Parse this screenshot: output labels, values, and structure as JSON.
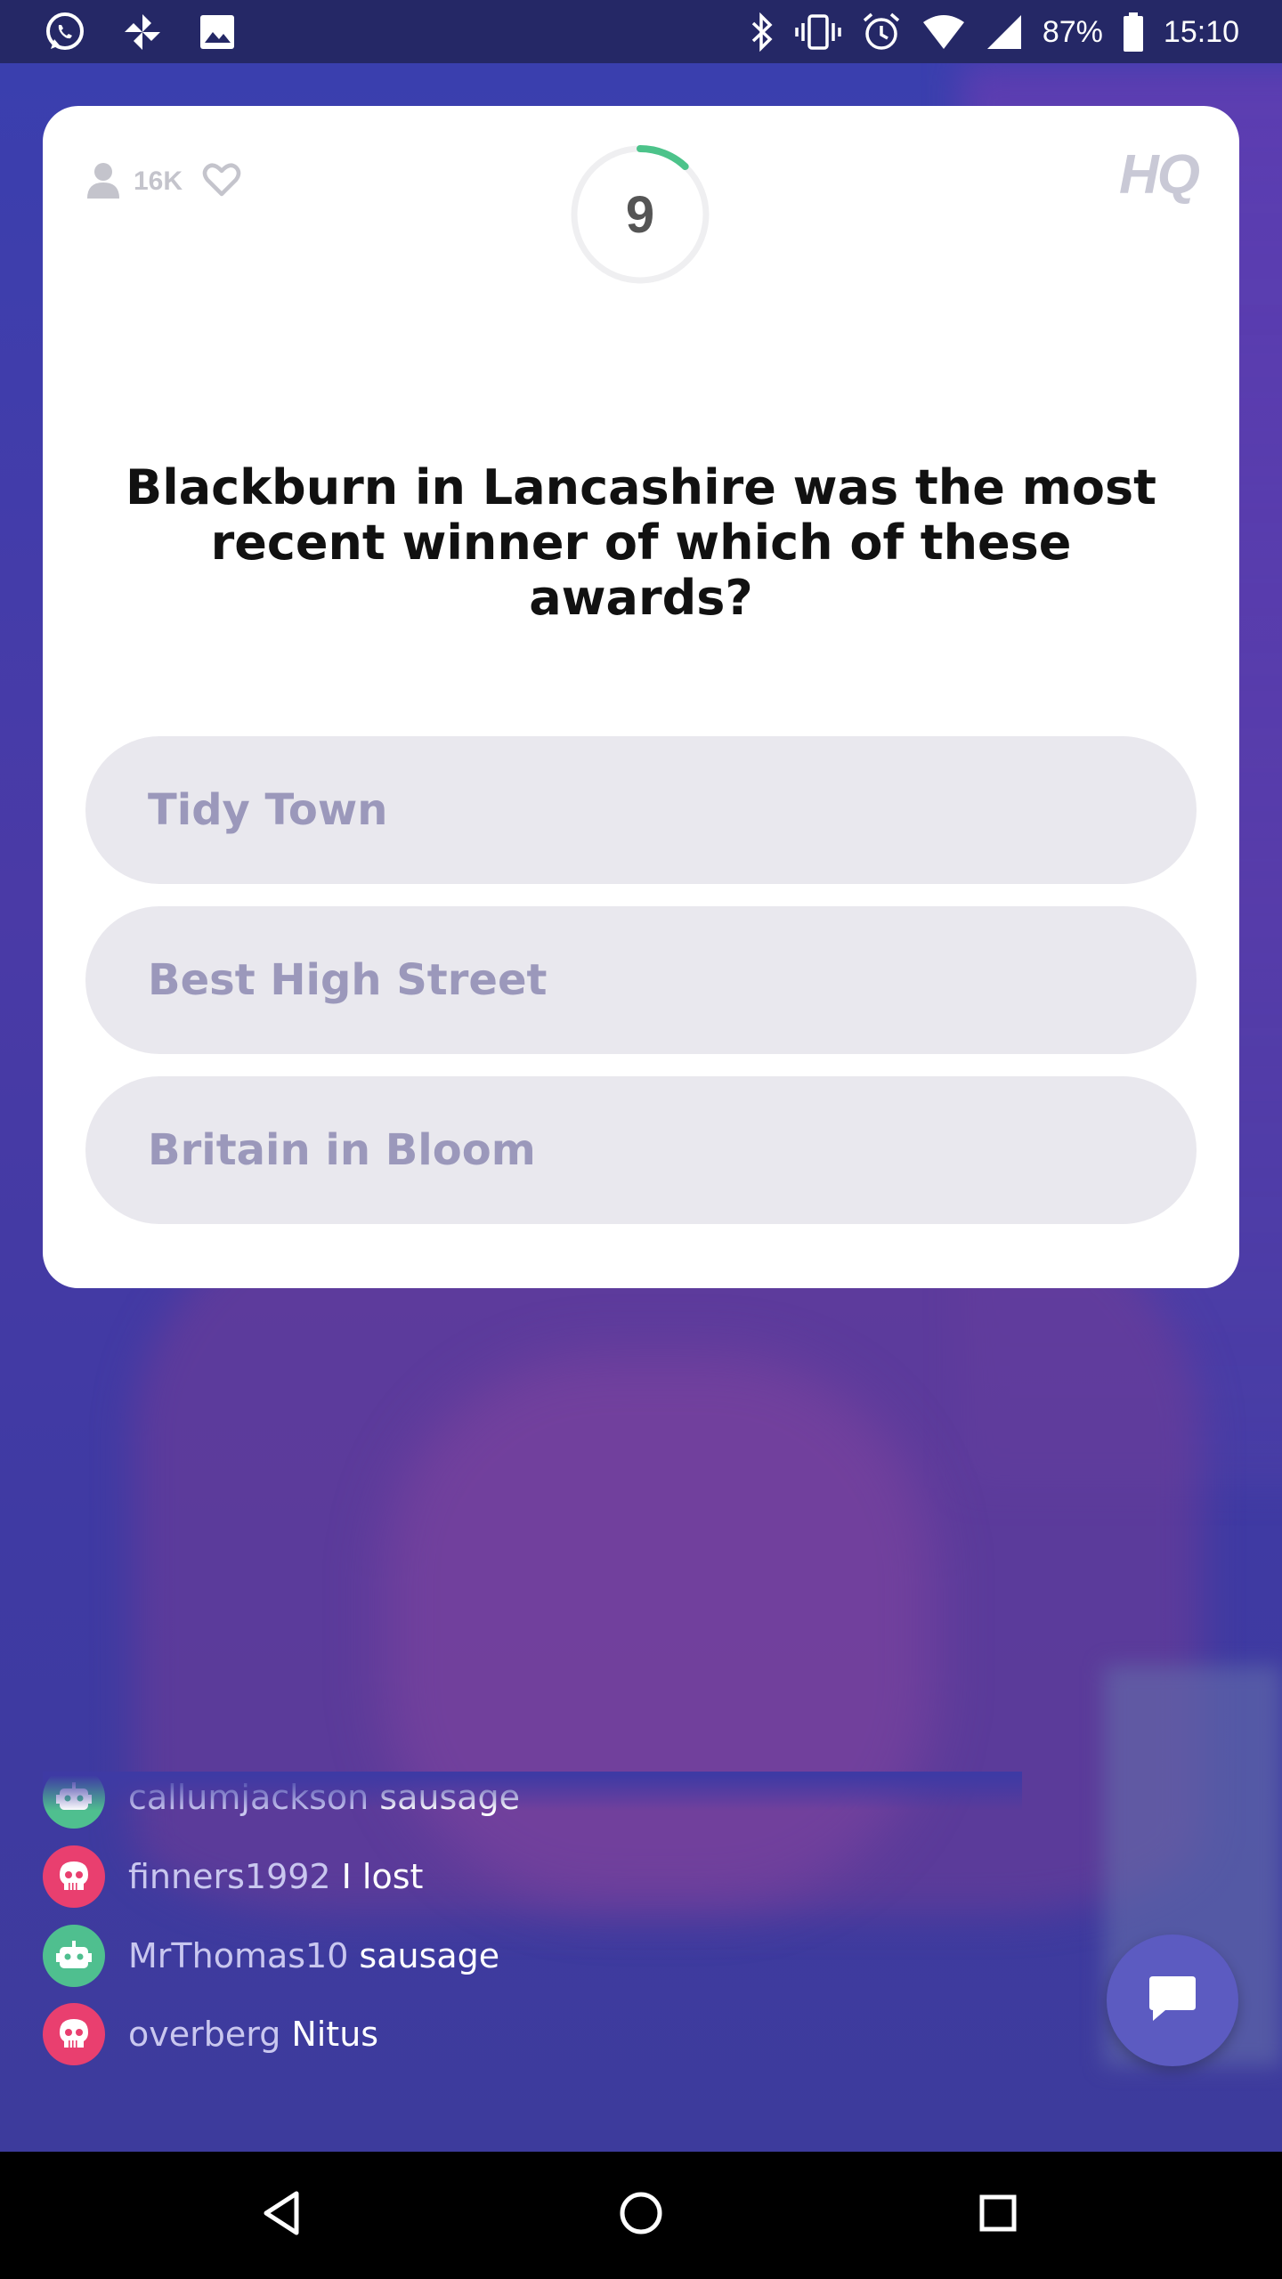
{
  "status_bar": {
    "left_icons": [
      "whatsapp-icon",
      "pinwheel-icon",
      "image-icon"
    ],
    "right_icons": [
      "bluetooth-icon",
      "vibrate-icon",
      "alarm-icon",
      "wifi-icon",
      "signal-icon"
    ],
    "battery": "87%",
    "time": "15:10"
  },
  "header": {
    "viewer_count": "16K",
    "timer": "9",
    "timer_progress": 0.12,
    "logo": "HQ"
  },
  "question": {
    "text": "Blackburn in Lancashire was the most recent winner of which of these awards?"
  },
  "answers": [
    {
      "label": "Tidy Town"
    },
    {
      "label": "Best High Street"
    },
    {
      "label": "Britain in Bloom"
    }
  ],
  "chat": {
    "messages": [
      {
        "username": "callumjackson",
        "text": "sausage",
        "avatar": "robot-icon",
        "avatar_color": "#4fbf8f"
      },
      {
        "username": "finners1992",
        "text": "I lost",
        "avatar": "skull-icon",
        "avatar_color": "#e93f6f"
      },
      {
        "username": "MrThomas10",
        "text": "sausage",
        "avatar": "robot-icon",
        "avatar_color": "#4fbf8f"
      },
      {
        "username": "overberg",
        "text": "Nitus",
        "avatar": "skull-icon",
        "avatar_color": "#e93f6f"
      }
    ]
  },
  "colors": {
    "timer_accent": "#4cc38a",
    "chat_button": "#5c5bc1",
    "answer_bg": "#e9e8ee",
    "answer_text": "#9b98bb"
  },
  "nav": {
    "buttons": [
      "back-icon",
      "home-icon",
      "recents-icon"
    ]
  }
}
